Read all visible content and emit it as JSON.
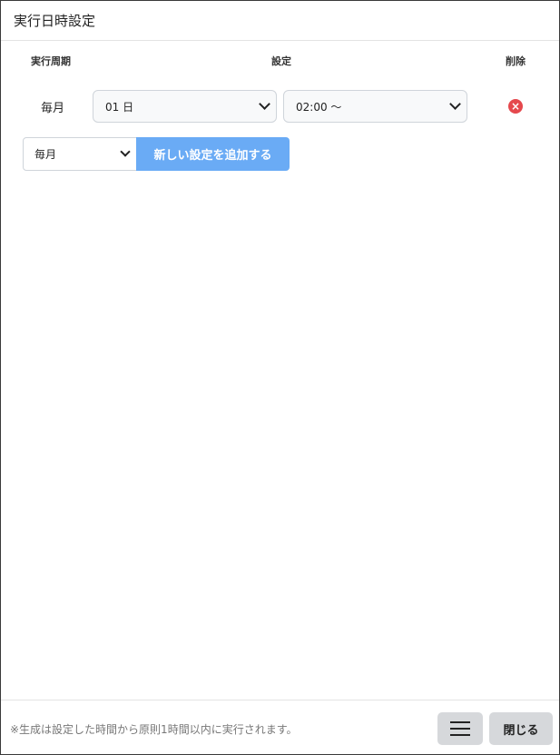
{
  "dialog": {
    "title": "実行日時設定"
  },
  "table": {
    "headers": {
      "period": "実行周期",
      "setting": "設定",
      "delete": "削除"
    },
    "rows": [
      {
        "period": "毎月",
        "day_value": "01 日",
        "time_value": "02:00 ～",
        "delete_icon": "close-circle-icon"
      }
    ]
  },
  "add": {
    "period_select_value": "毎月",
    "add_button_label": "新しい設定を追加する"
  },
  "footer": {
    "note": "※生成は設定した時間から原則1時間以内に実行されます。",
    "menu_icon": "hamburger-menu-icon",
    "close_label": "閉じる"
  },
  "colors": {
    "add_button": "#6aabf5",
    "delete_icon": "#e5484d",
    "footer_buttons": "#d6d8db"
  }
}
